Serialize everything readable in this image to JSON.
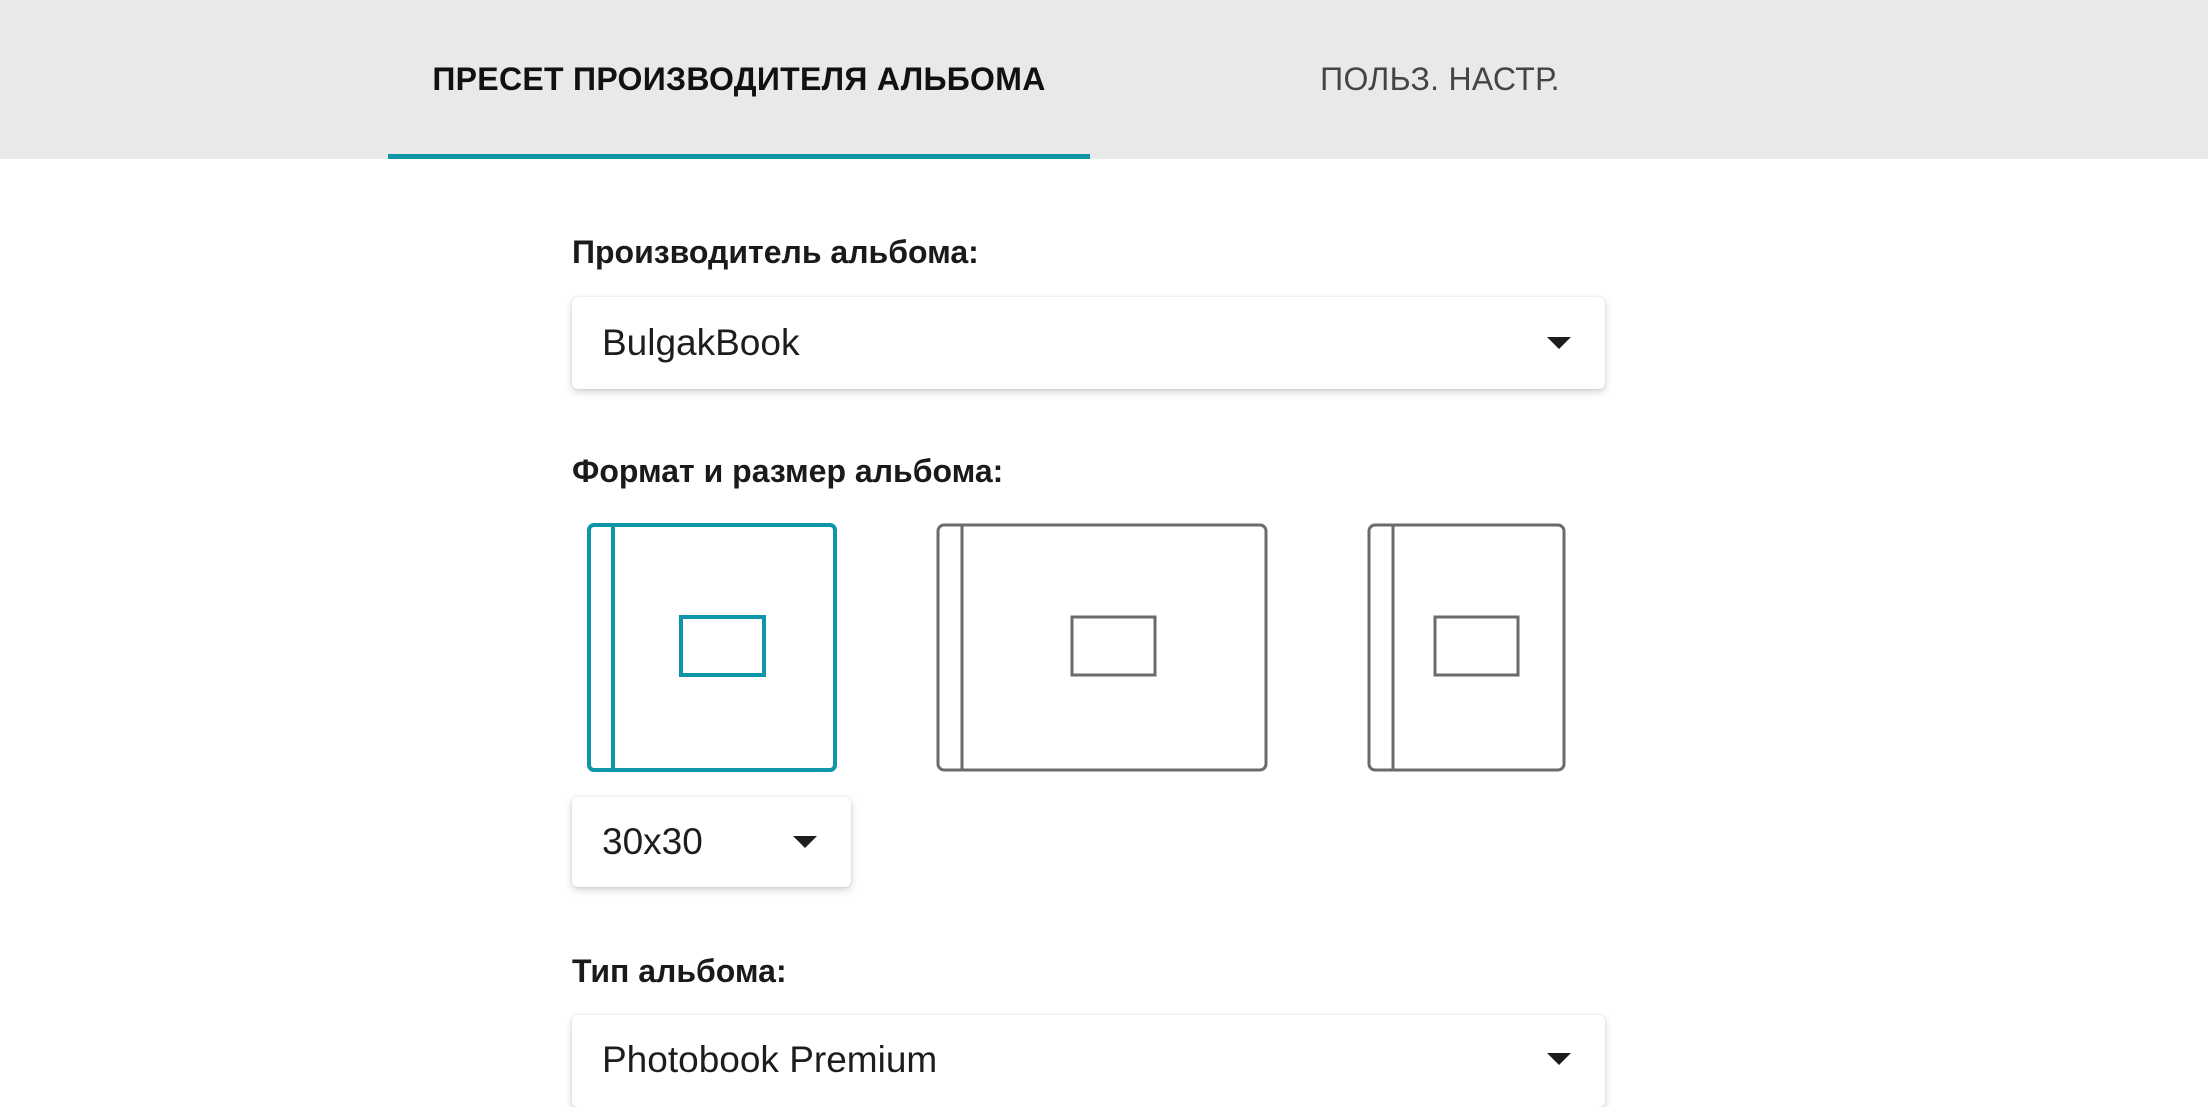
{
  "tabs": {
    "preset_label": "ПРЕСЕТ ПРОИЗВОДИТЕЛЯ АЛЬБОМА",
    "custom_label": "ПОЛЬЗ. НАСТР."
  },
  "manufacturer": {
    "label": "Производитель альбома:",
    "selected": "BulgakBook"
  },
  "format": {
    "label": "Формат и размер альбома:",
    "options": [
      "square",
      "landscape",
      "portrait"
    ],
    "selected_option": "square",
    "size_selected": "30x30"
  },
  "album_type": {
    "label": "Тип альбома:",
    "selected": "Photobook Premium"
  },
  "colors": {
    "accent": "#0e96a8",
    "inactive_outline": "#6b6b6b",
    "topbar": "#e9e9e9"
  }
}
